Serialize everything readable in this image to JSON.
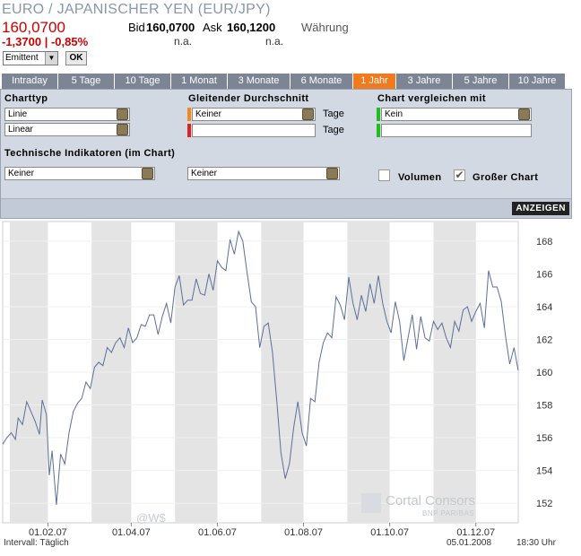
{
  "header": {
    "title": "EURO / JAPANISCHER YEN (EUR/JPY)",
    "price": "160,0700",
    "change": "-1,3700 | -0,85%",
    "bid_label": "Bid",
    "bid_value": "160,0700",
    "ask_label": "Ask",
    "ask_value": "160,1200",
    "currency_label": "Währung",
    "bid_na": "n.a.",
    "ask_na": "n.a.",
    "issuer_select": "Emittent",
    "ok_label": "OK"
  },
  "tabs": [
    {
      "label": "Intraday"
    },
    {
      "label": "5 Tage"
    },
    {
      "label": "10 Tage"
    },
    {
      "label": "1 Monat"
    },
    {
      "label": "3 Monate"
    },
    {
      "label": "6 Monate"
    },
    {
      "label": "1 Jahr",
      "active": true
    },
    {
      "label": "3 Jahre"
    },
    {
      "label": "5 Jahre"
    },
    {
      "label": "10 Jahre"
    }
  ],
  "settings": {
    "charttyp_label": "Charttyp",
    "charttyp_value": "Linie",
    "scale_value": "Linear",
    "ma_label": "Gleitender Durchschnitt",
    "ma1_value": "Keiner",
    "ma2_value": "",
    "days_label": "Tage",
    "compare_label": "Chart vergleichen mit",
    "compare1_value": "Kein",
    "compare2_value": "",
    "indicators_label": "Technische Indikatoren (im Chart)",
    "ind1_value": "Keiner",
    "ind2_value": "Keiner",
    "volume_label": "Volumen",
    "bigchart_label": "Großer Chart",
    "show_label": "ANZEIGEN",
    "colors": {
      "ma1": "#f08a1c",
      "ma2": "#dd2222",
      "compare1": "#22bb22",
      "compare2": "#22bb22"
    }
  },
  "footer": {
    "interval": "Intervall: Täglich",
    "date": "05.01.2008",
    "time": "18:30 Uhr",
    "watermark": "@W$",
    "logo_main": "Cortal Consors",
    "logo_sub": "BNP PARIBAS"
  },
  "chart_data": {
    "type": "line",
    "xlabels": [
      "01.02.07",
      "01.04.07",
      "01.06.07",
      "01.08.07",
      "01.10.07",
      "01.12.07"
    ],
    "yticks": [
      152,
      154,
      156,
      158,
      160,
      162,
      164,
      166,
      168
    ],
    "ylim": [
      150.8,
      169.2
    ],
    "grid": true,
    "x": [
      0,
      3,
      6,
      9,
      11,
      14,
      17,
      20,
      23,
      26,
      28,
      31,
      33,
      35,
      38,
      41,
      44,
      47,
      50,
      53,
      56,
      59,
      62,
      65,
      68,
      71,
      74,
      77,
      80,
      83,
      86,
      89,
      92,
      95,
      98,
      101,
      104,
      107,
      110,
      113,
      116,
      119,
      122,
      125,
      128,
      131,
      134,
      137,
      140,
      143,
      146,
      149,
      152,
      155,
      158,
      161,
      164,
      167,
      170,
      173,
      176,
      179,
      182,
      185,
      188,
      191,
      194,
      197,
      200,
      203,
      206,
      209,
      212,
      215,
      218,
      221,
      224,
      227,
      230,
      233,
      236,
      239,
      242,
      245,
      248,
      251,
      254,
      257,
      260,
      263,
      266,
      269,
      272,
      275,
      278,
      281,
      284,
      287,
      290,
      293,
      296,
      299,
      302,
      305,
      308,
      311,
      314,
      317,
      320,
      323,
      326,
      329,
      332,
      335,
      338,
      341,
      344,
      347,
      350,
      353,
      356,
      359,
      362,
      365
    ],
    "y": [
      155.6,
      156.0,
      156.3,
      155.9,
      157.2,
      156.8,
      158.2,
      157.6,
      157.0,
      156.2,
      158.3,
      157.4,
      153.7,
      155.2,
      151.9,
      155.0,
      154.4,
      156.3,
      157.6,
      158.1,
      158.4,
      159.4,
      159.0,
      160.3,
      160.6,
      160.4,
      161.5,
      161.2,
      161.8,
      162.1,
      161.5,
      162.7,
      161.8,
      162.1,
      162.9,
      162.8,
      163.5,
      163.5,
      162.3,
      163.4,
      164.2,
      163.0,
      165.2,
      165.9,
      164.1,
      164.4,
      164.4,
      165.7,
      164.8,
      164.7,
      166.0,
      165.0,
      166.8,
      166.4,
      166.2,
      168.1,
      167.2,
      168.6,
      168.0,
      166.1,
      164.3,
      164.0,
      161.5,
      162.8,
      163.0,
      161.2,
      158.3,
      155.1,
      153.5,
      154.4,
      156.6,
      158.2,
      156.3,
      155.5,
      158.4,
      158.2,
      160.6,
      161.8,
      162.4,
      162.1,
      164.6,
      164.1,
      163.2,
      165.8,
      164.2,
      163.2,
      164.7,
      163.7,
      165.4,
      164.2,
      165.9,
      164.2,
      163.1,
      162.4,
      164.3,
      163.1,
      160.7,
      162.1,
      163.5,
      161.4,
      163.4,
      162.1,
      161.9,
      163.1,
      162.6,
      163.0,
      162.1,
      161.5,
      163.1,
      162.5,
      163.8,
      164.0,
      163.1,
      163.7,
      164.2,
      162.7,
      166.2,
      165.2,
      165.2,
      164.3,
      162.2,
      160.5,
      161.5,
      160.1
    ],
    "date_ticks_x": [
      32,
      91,
      152,
      213,
      274,
      335
    ]
  }
}
